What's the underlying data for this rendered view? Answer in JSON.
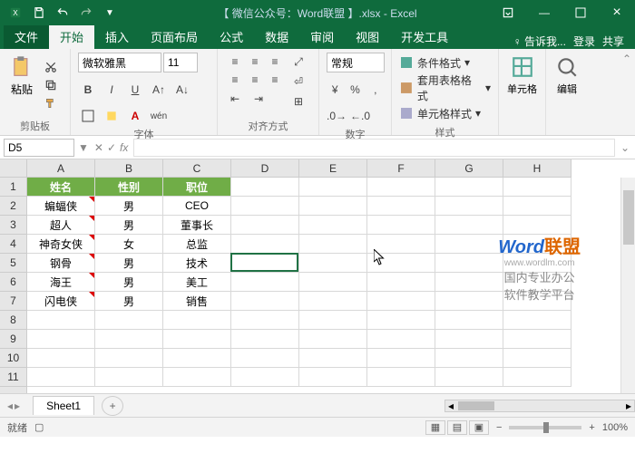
{
  "title": "【 微信公众号：Word联盟 】.xlsx - Excel",
  "tabs": {
    "file": "文件",
    "home": "开始",
    "insert": "插入",
    "pagelayout": "页面布局",
    "formulas": "公式",
    "data": "数据",
    "review": "审阅",
    "view": "视图",
    "dev": "开发工具",
    "tell": "告诉我...",
    "signin": "登录",
    "share": "共享"
  },
  "ribbon": {
    "clipboard": "剪贴板",
    "paste": "粘贴",
    "font_group": "字体",
    "font_name": "微软雅黑",
    "font_size": "11",
    "align_group": "对齐方式",
    "number_group": "数字",
    "number_format": "常规",
    "styles_group": "样式",
    "cond_fmt": "条件格式",
    "table_fmt": "套用表格格式",
    "cell_style": "单元格样式",
    "cells_group": "单元格",
    "edit_group": "编辑"
  },
  "namebox": "D5",
  "columns": [
    "A",
    "B",
    "C",
    "D",
    "E",
    "F",
    "G",
    "H"
  ],
  "rows": [
    "1",
    "2",
    "3",
    "4",
    "5",
    "6",
    "7",
    "8",
    "9",
    "10",
    "11"
  ],
  "header_row": {
    "A": "姓名",
    "B": "性别",
    "C": "职位"
  },
  "data_rows": [
    {
      "A": "蝙蝠侠",
      "B": "男",
      "C": "CEO"
    },
    {
      "A": "超人",
      "B": "男",
      "C": "董事长"
    },
    {
      "A": "神奇女侠",
      "B": "女",
      "C": "总监"
    },
    {
      "A": "钢骨",
      "B": "男",
      "C": "技术"
    },
    {
      "A": "海王",
      "B": "男",
      "C": "美工"
    },
    {
      "A": "闪电侠",
      "B": "男",
      "C": "销售"
    }
  ],
  "watermark": {
    "brand1": "Word",
    "brand2": "联盟",
    "url": "www.wordlm.com",
    "line1": "国内专业办公",
    "line2": "软件教学平台"
  },
  "sheet": {
    "name": "Sheet1"
  },
  "status": {
    "ready": "就绪",
    "zoom": "100%"
  }
}
